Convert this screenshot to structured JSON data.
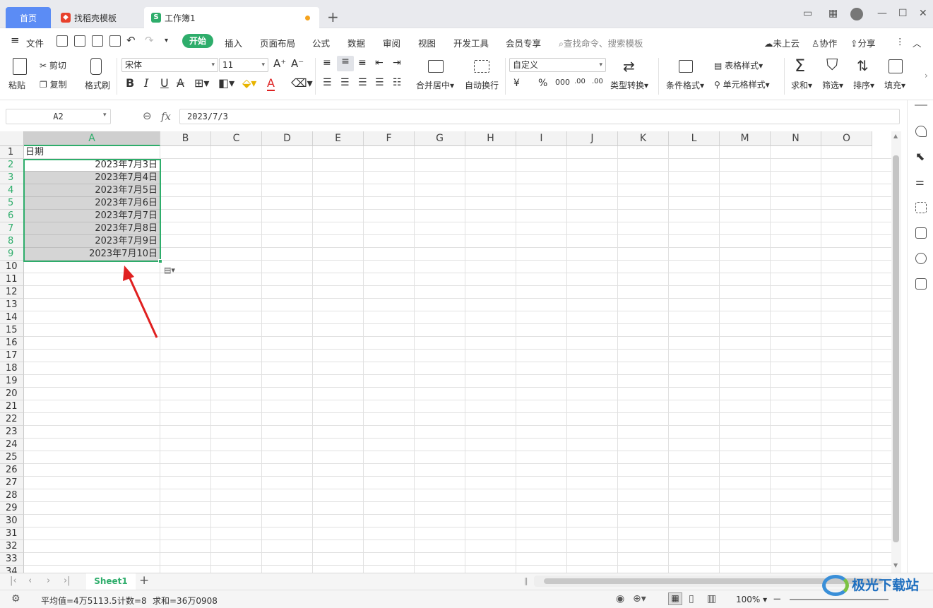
{
  "tabs": {
    "home": "首页",
    "templates": "找稻壳模板",
    "workbook": "工作簿1",
    "new_tab": "+"
  },
  "menu": {
    "file": "文件",
    "start": "开始",
    "items": [
      "插入",
      "页面布局",
      "公式",
      "数据",
      "审阅",
      "视图",
      "开发工具",
      "会员专享"
    ],
    "search_placeholder": "查找命令、搜索模板",
    "cloud": "未上云",
    "collab": "协作",
    "share": "分享"
  },
  "ribbon": {
    "paste": "粘贴",
    "cut": "剪切",
    "copy": "复制",
    "format_painter": "格式刷",
    "font_name": "宋体",
    "font_size": "11",
    "bold": "B",
    "italic": "I",
    "underline": "U",
    "strike": "A",
    "font_color": "A",
    "merge": "合并居中",
    "wrap": "自动换行",
    "number_format": "自定义",
    "currency": "¥",
    "percent": "%",
    "thousands": "000",
    "inc_decimal": ".00",
    "dec_decimal": ".00",
    "type_convert": "类型转换",
    "conditional_format": "条件格式",
    "table_style": "表格样式",
    "cell_style": "单元格样式",
    "sum": "求和",
    "filter": "筛选",
    "sort": "排序",
    "fill": "填充"
  },
  "formula_bar": {
    "name_box": "A2",
    "fx": "fx",
    "value": "2023/7/3"
  },
  "grid": {
    "columns": [
      "A",
      "B",
      "C",
      "D",
      "E",
      "F",
      "G",
      "H",
      "I",
      "J",
      "K",
      "L",
      "M",
      "N",
      "O"
    ],
    "rows": [
      "1",
      "2",
      "3",
      "4",
      "5",
      "6",
      "7",
      "8",
      "9",
      "10",
      "11",
      "12",
      "13",
      "14",
      "15",
      "16",
      "17",
      "18",
      "19",
      "20",
      "21",
      "22",
      "23",
      "24",
      "25",
      "26",
      "27",
      "28",
      "29",
      "30",
      "31",
      "32",
      "33",
      "34"
    ],
    "header_cell": "日期",
    "dates": [
      "2023年7月3日",
      "2023年7月4日",
      "2023年7月5日",
      "2023年7月6日",
      "2023年7月7日",
      "2023年7月8日",
      "2023年7月9日",
      "2023年7月10日"
    ]
  },
  "sheets": {
    "active": "Sheet1",
    "add": "+"
  },
  "status": {
    "average": "平均值=4万5113.5",
    "count": "计数=8",
    "sum": "求和=36万0908",
    "zoom": "100%"
  },
  "colors": {
    "accent": "#2ead6b",
    "tab_blue": "#5b8cf5",
    "arrow_red": "#e02020"
  },
  "watermark": "极光下载站"
}
